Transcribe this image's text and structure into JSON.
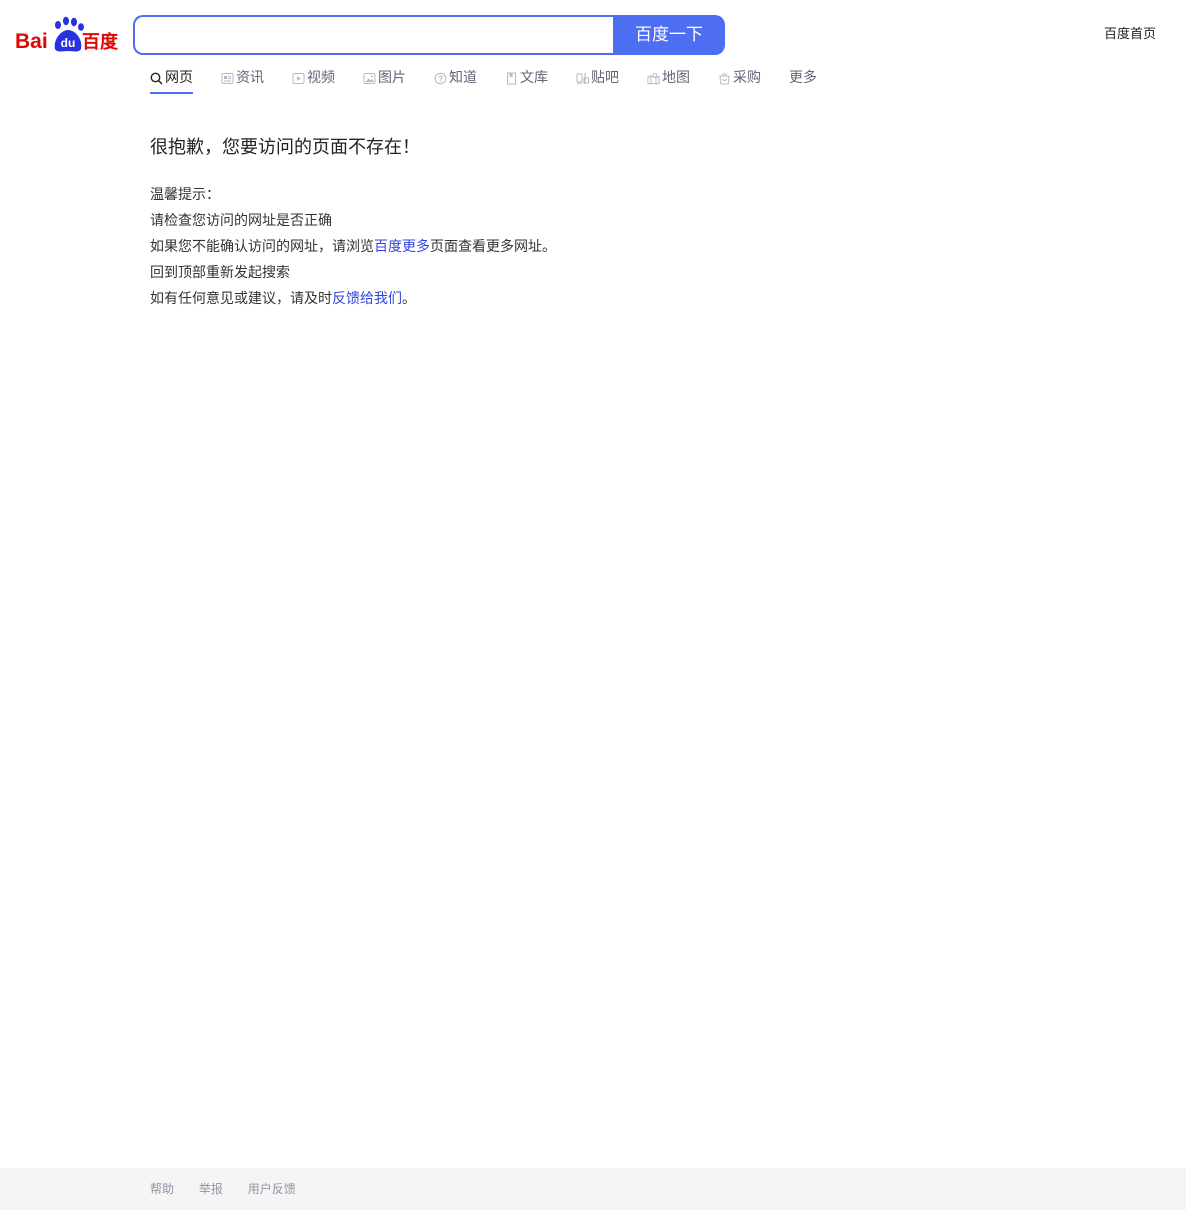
{
  "logo": {
    "text_left": "Bai",
    "text_paw": "du",
    "text_right": "百度"
  },
  "search": {
    "value": "",
    "placeholder": "",
    "button_label": "百度一下"
  },
  "header": {
    "home_link": "百度首页"
  },
  "nav": {
    "items": [
      {
        "label": "网页",
        "icon": "search-icon",
        "active": true
      },
      {
        "label": "资讯",
        "icon": "news-icon",
        "active": false
      },
      {
        "label": "视频",
        "icon": "video-icon",
        "active": false
      },
      {
        "label": "图片",
        "icon": "image-icon",
        "active": false
      },
      {
        "label": "知道",
        "icon": "question-icon",
        "active": false
      },
      {
        "label": "文库",
        "icon": "document-icon",
        "active": false
      },
      {
        "label": "贴吧",
        "icon": "tieba-icon",
        "active": false
      },
      {
        "label": "地图",
        "icon": "map-icon",
        "active": false
      },
      {
        "label": "采购",
        "icon": "shopping-icon",
        "active": false
      },
      {
        "label": "更多",
        "icon": "",
        "active": false
      }
    ]
  },
  "main": {
    "title": "很抱歉，您要访问的页面不存在！",
    "tips_heading": "温馨提示：",
    "tip_1": "请检查您访问的网址是否正确",
    "tip_2_prefix": "如果您不能确认访问的网址，请浏览",
    "tip_2_link": "百度更多",
    "tip_2_suffix": "页面查看更多网址。",
    "tip_3": "回到顶部重新发起搜索",
    "tip_4_prefix": "如有任何意见或建议，请及时",
    "tip_4_link": "反馈给我们",
    "tip_4_suffix": "。"
  },
  "footer": {
    "links": [
      "帮助",
      "举报",
      "用户反馈"
    ]
  },
  "colors": {
    "brand_blue": "#4e6ef2",
    "brand_red": "#e10601",
    "link_blue": "#3245df",
    "footer_bg": "#f5f5f6"
  }
}
